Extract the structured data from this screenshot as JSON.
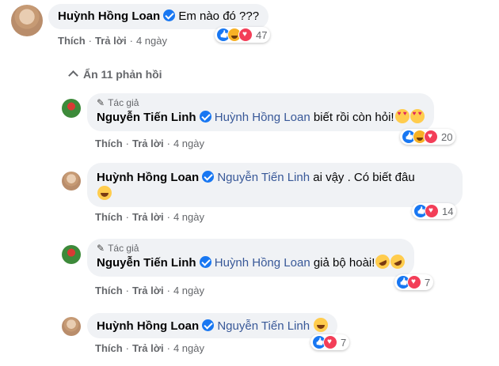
{
  "comment": {
    "author": "Huỳnh Hồng Loan",
    "text": "Em nào đó ???",
    "actions": {
      "like": "Thích",
      "reply": "Trả lời",
      "time": "4 ngày"
    },
    "reaction_count": "47"
  },
  "replies_toggle": "Ẩn 11 phản hồi",
  "replies": [
    {
      "author_tag": "Tác giả",
      "author": "Nguyễn Tiến Linh",
      "mention": "Huỳnh Hồng Loan",
      "text": "biết rồi còn hỏi!",
      "emojis": [
        "heart-eyes",
        "heart-eyes"
      ],
      "actions": {
        "like": "Thích",
        "reply": "Trả lời",
        "time": "4 ngày"
      },
      "reaction_count": "20"
    },
    {
      "author": "Huỳnh Hồng Loan",
      "mention": "Nguyễn Tiến Linh",
      "text": "ai vậy . Có biết đâu",
      "emojis": [
        "grinning"
      ],
      "actions": {
        "like": "Thích",
        "reply": "Trả lời",
        "time": "4 ngày"
      },
      "reaction_count": "14"
    },
    {
      "author_tag": "Tác giả",
      "author": "Nguyễn Tiến Linh",
      "mention": "Huỳnh Hồng Loan",
      "text": "giả bộ hoài!",
      "emojis": [
        "rofl",
        "rofl"
      ],
      "actions": {
        "like": "Thích",
        "reply": "Trả lời",
        "time": "4 ngày"
      },
      "reaction_count": "7"
    },
    {
      "author": "Huỳnh Hồng Loan",
      "mention": "Nguyễn Tiến Linh",
      "text": "",
      "emojis": [
        "grinning"
      ],
      "actions": {
        "like": "Thích",
        "reply": "Trả lời",
        "time": "4 ngày"
      },
      "reaction_count": "7"
    }
  ],
  "colors": {
    "link": "#385898",
    "bubble": "#f0f2f5",
    "meta": "#65676b",
    "verified": "#1877f2"
  }
}
